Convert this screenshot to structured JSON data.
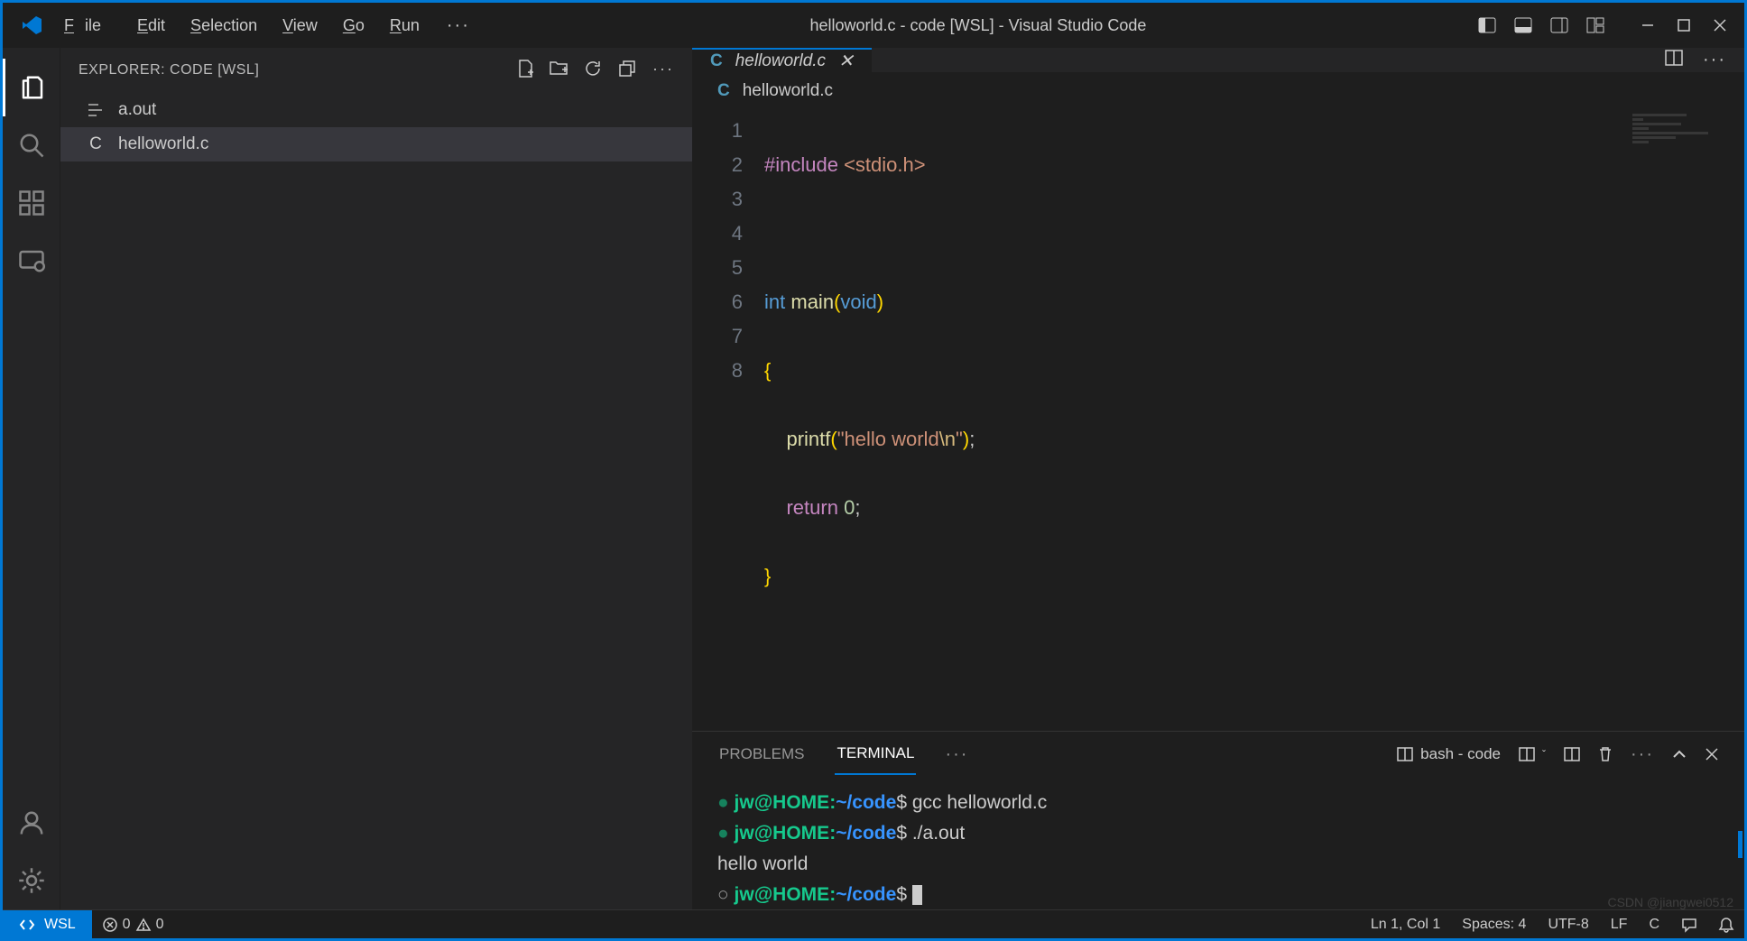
{
  "title": "helloworld.c - code [WSL] - Visual Studio Code",
  "menu": {
    "file": "File",
    "edit": "Edit",
    "selection": "Selection",
    "view": "View",
    "go": "Go",
    "run": "Run"
  },
  "explorer": {
    "title": "EXPLORER: CODE [WSL]",
    "files": [
      {
        "icon": "list",
        "name": "a.out"
      },
      {
        "icon": "C",
        "name": "helloworld.c",
        "selected": true
      }
    ]
  },
  "tab": {
    "label": "helloworld.c"
  },
  "breadcrumb": {
    "label": "helloworld.c"
  },
  "code": {
    "line_count": 8,
    "l1_pp": "#include",
    "l1_inc": "<stdio.h>",
    "l3_kw": "int",
    "l3_fn": "main",
    "l3_void": "void",
    "l5_fn": "printf",
    "l5_str_open": "\"hello world",
    "l5_esc": "\\n",
    "l5_str_close": "\"",
    "l6_ret": "return",
    "l6_num": "0"
  },
  "panel": {
    "tabs": {
      "problems": "PROBLEMS",
      "terminal": "TERMINAL"
    },
    "shell_label": "bash - code"
  },
  "terminal": {
    "prompt_user": "jw@HOME",
    "prompt_sep": ":",
    "prompt_path": "~/code",
    "prompt_end": "$",
    "cmd1": "gcc helloworld.c",
    "cmd2": "./a.out",
    "output": "hello world"
  },
  "status": {
    "remote": "WSL",
    "errors": "0",
    "warnings": "0",
    "ln_col": "Ln 1, Col 1",
    "spaces": "Spaces: 4",
    "encoding": "UTF-8",
    "eol": "LF",
    "lang": "C"
  },
  "watermark": "CSDN @jiangwei0512"
}
